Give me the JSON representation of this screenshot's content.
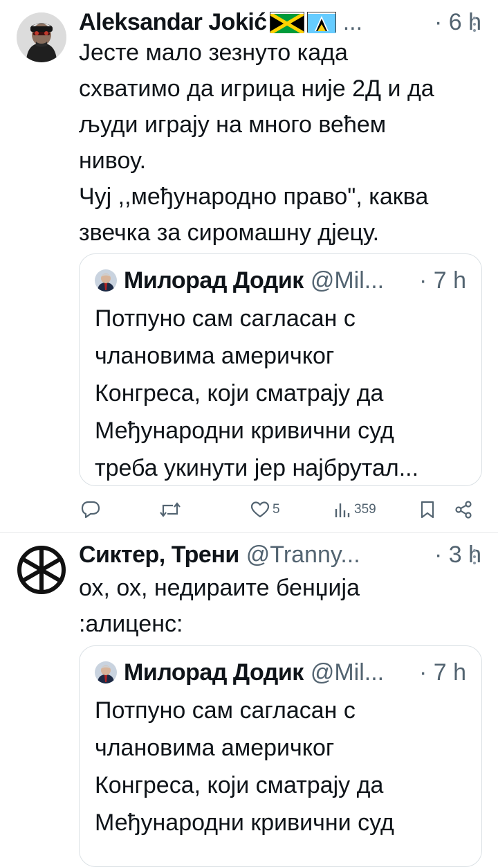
{
  "tweets": [
    {
      "author_name": "Aleksandar Jokić",
      "author_flags": [
        "jamaica-flag",
        "saint-lucia-flag"
      ],
      "ellipsis": "...",
      "time": "· 6 h",
      "text_lines": [
        "Јесте мало зезнуто када",
        "схватимо да игрица није 2Д и да",
        "људи играју на много већем",
        "нивоу.",
        "Чуј ,,међународно право\", каква",
        "звечка за сиромашну дјецу."
      ],
      "quote": {
        "author_name": "Милорад Додик",
        "handle": "@Mil...",
        "time": "· 7 h",
        "text_lines": [
          "Потпуно сам сагласан с",
          "члановима америчког",
          "Конгреса, који сматрају да",
          "Међународни кривични суд",
          "треба укинути јер најбрутал..."
        ]
      },
      "actions": {
        "reply_count": "",
        "retweet_count": "",
        "like_count": "5",
        "view_count": "359"
      }
    },
    {
      "author_name": "Сиктер, Трени",
      "handle": "@Tranny...",
      "time": "· 3 h",
      "text_lines": [
        "ох, ох, недираите бенџија",
        ":алиценс:"
      ],
      "quote": {
        "author_name": "Милорад Додик",
        "handle": "@Mil...",
        "time": "· 7 h",
        "text_lines": [
          "Потпуно сам сагласан с",
          "члановима америчког",
          "Конгреса, који сматрају да",
          "Међународни кривични суд"
        ]
      }
    }
  ],
  "colors": {
    "text": "#0f1419",
    "secondary": "#536471",
    "border": "#dbe1e5",
    "divider": "#e7e9ea"
  }
}
